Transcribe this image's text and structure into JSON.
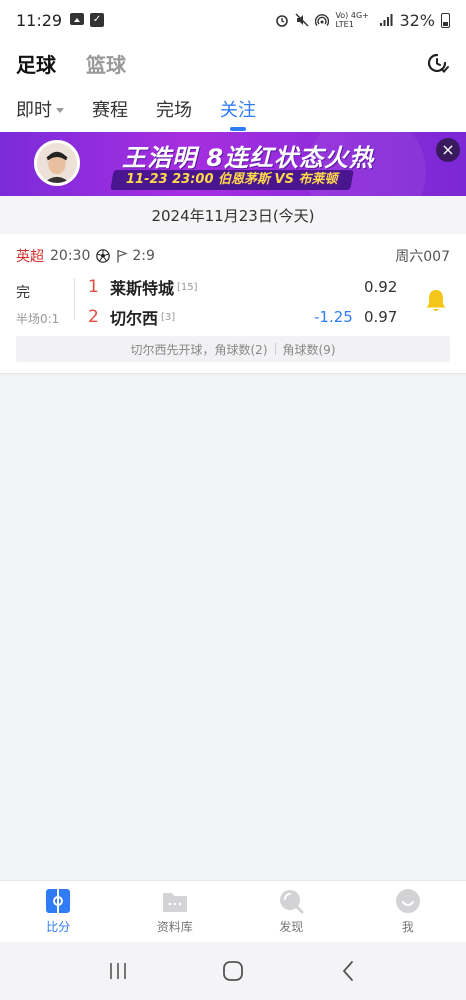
{
  "status_bar": {
    "time": "11:29",
    "network": "Vo) 4G+ LTE1",
    "battery": "32%"
  },
  "sport_tabs": [
    {
      "label": "足球"
    },
    {
      "label": "篮球"
    }
  ],
  "sub_tabs": [
    {
      "label": "即时"
    },
    {
      "label": "赛程"
    },
    {
      "label": "完场"
    },
    {
      "label": "关注"
    }
  ],
  "banner": {
    "title": "王浩明  8连红状态火热",
    "subtitle": "11-23 23:00  伯恩茅斯 VS 布莱顿",
    "close": "×"
  },
  "date_label": "2024年11月23日(今天)",
  "match": {
    "league": "英超",
    "time": "20:30",
    "corner_ratio": "2:9",
    "match_no": "周六007",
    "status": "完",
    "half_score": "半场0:1",
    "home": {
      "score": "1",
      "name": "莱斯特城",
      "rank": "[15]",
      "odds": "0.92"
    },
    "away": {
      "score": "2",
      "name": "切尔西",
      "rank": "[3]",
      "handicap": "-1.25",
      "odds": "0.97"
    },
    "events": [
      "切尔西先开球，角球数(2)",
      "角球数(9)"
    ]
  },
  "bottom_nav": [
    {
      "label": "比分",
      "icon": "score-icon"
    },
    {
      "label": "资料库",
      "icon": "folder-icon"
    },
    {
      "label": "发现",
      "icon": "discover-icon"
    },
    {
      "label": "我",
      "icon": "profile-icon"
    }
  ],
  "colors": {
    "accent": "#2f7cf6",
    "league": "#d0312d",
    "score": "#e04d43",
    "banner_start": "#7b2bd9",
    "bell": "#f5c518"
  }
}
